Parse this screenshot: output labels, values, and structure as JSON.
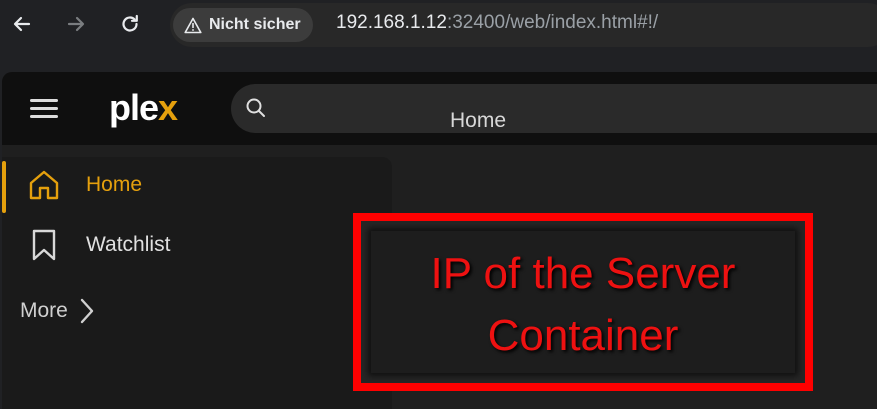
{
  "browser": {
    "security_label": "Nicht sicher",
    "url_host": "192.168.1.12",
    "url_rest": ":32400/web/index.html#!/",
    "icons": [
      "back-arrow-icon",
      "forward-arrow-icon",
      "reload-icon",
      "warning-triangle-icon"
    ]
  },
  "app": {
    "logo_main": "ple",
    "logo_accent": "x",
    "accent_color": "#e5a00d",
    "search": {
      "placeholder": ""
    },
    "sidebar": {
      "items": [
        {
          "label": "Home",
          "icon": "home-icon",
          "active": true
        },
        {
          "label": "Watchlist",
          "icon": "bookmark-icon",
          "active": false
        }
      ],
      "more_label": "More"
    },
    "main_title": "Home"
  },
  "annotation": {
    "line1": "IP of the Server",
    "line2": "Container",
    "color": "#ff0000"
  }
}
